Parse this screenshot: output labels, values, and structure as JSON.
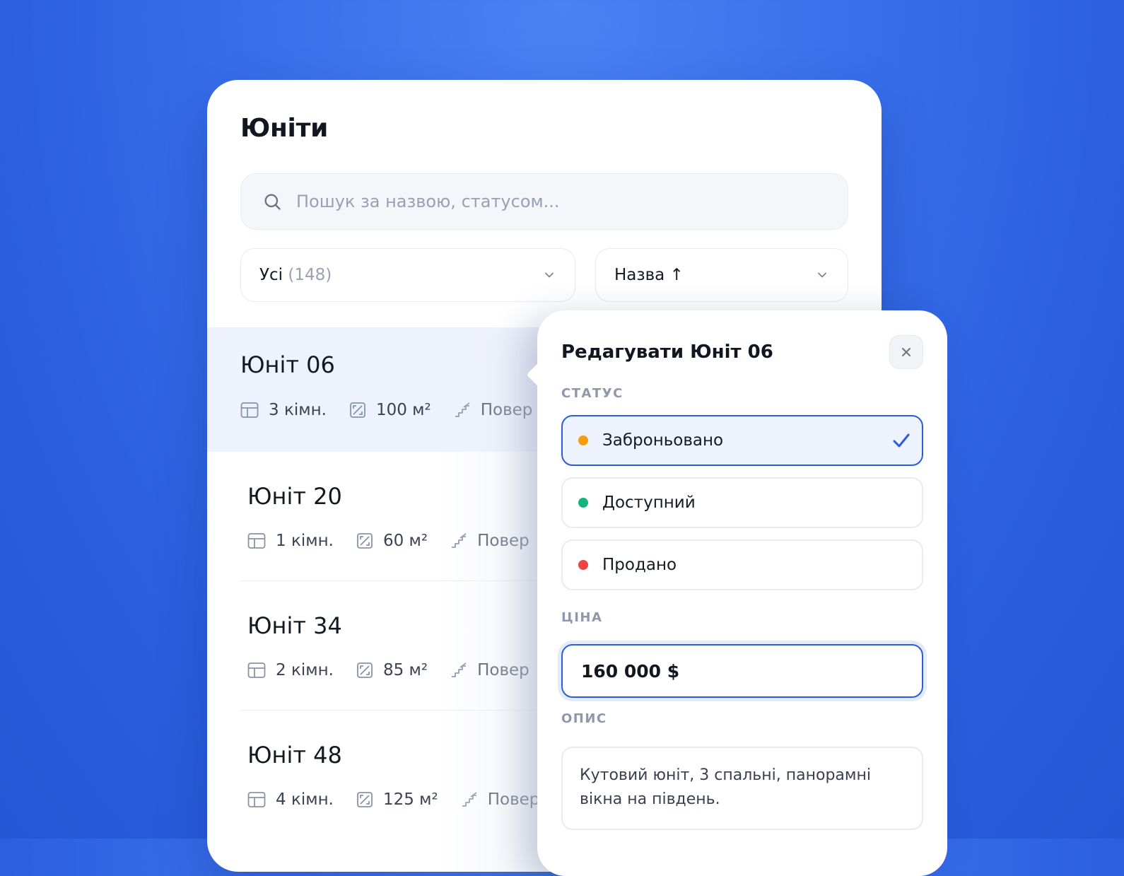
{
  "units_panel": {
    "title": "Юніти",
    "search": {
      "placeholder": "Пошук за назвою, статусом..."
    },
    "filter": {
      "label": "Усі",
      "count": "(148)"
    },
    "sort": {
      "label": "Назва ↑"
    },
    "units": [
      {
        "name": "Юніт 06",
        "rooms": "3 кімн.",
        "area": "100 м²",
        "floor": "Повер",
        "active": true
      },
      {
        "name": "Юніт 20",
        "rooms": "1 кімн.",
        "area": "60 м²",
        "floor": "Повер"
      },
      {
        "name": "Юніт 34",
        "rooms": "2 кімн.",
        "area": "85 м²",
        "floor": "Повер"
      },
      {
        "name": "Юніт 48",
        "rooms": "4 кімн.",
        "area": "125 м²",
        "floor": "Повер"
      }
    ]
  },
  "editor": {
    "title": "Редагувати Юніт 06",
    "status_label": "СТАТУС",
    "statuses": [
      {
        "label": "Заброньовано",
        "color": "#f59e0b",
        "selected": true
      },
      {
        "label": "Доступний",
        "color": "#16b47a"
      },
      {
        "label": "Продано",
        "color": "#ef4444"
      }
    ],
    "price_label": "ЦІНА",
    "price_value": "160 000 $",
    "description_label": "ОПИС",
    "description_value": "Кутовий юніт, 3 спальні, панорамні вікна на південь."
  },
  "colors": {
    "accent": "#2a5ed8",
    "background": "#3a70ec",
    "active_row": "#eef2fd"
  },
  "icons": [
    "search-icon",
    "chevron-down-icon",
    "rooms-icon",
    "area-icon",
    "stairs-icon",
    "close-icon",
    "check-icon"
  ]
}
